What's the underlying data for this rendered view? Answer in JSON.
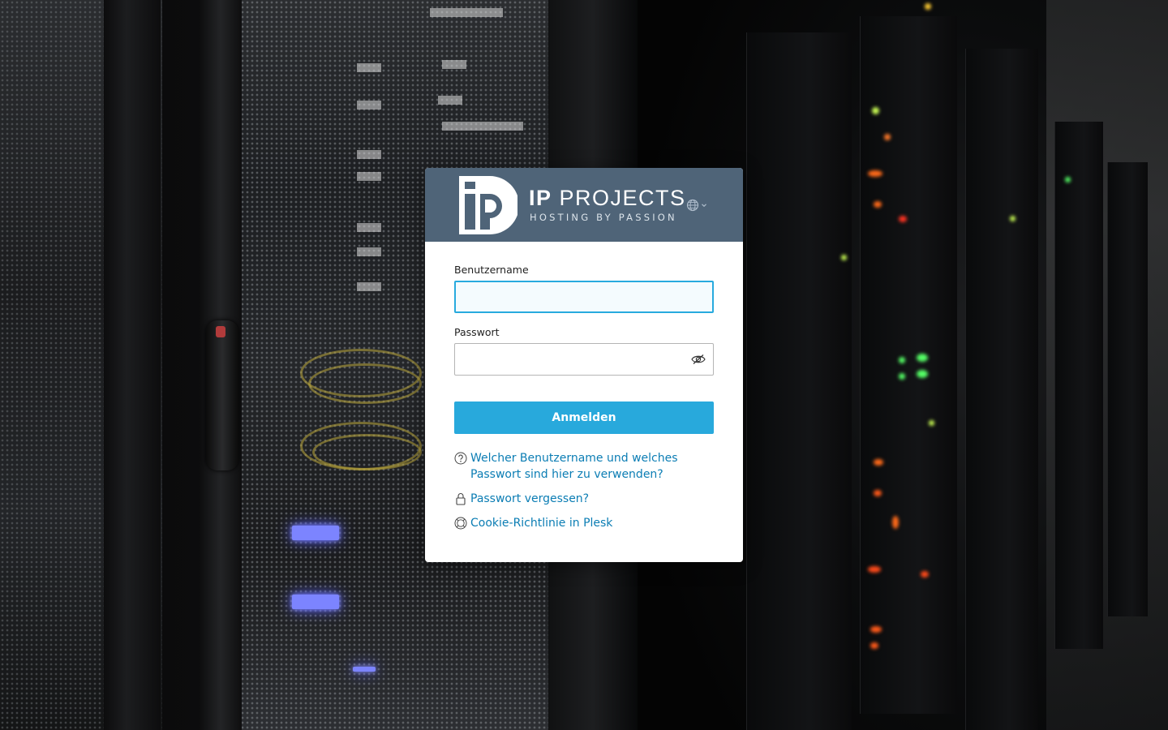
{
  "brand": {
    "name_bold": "IP",
    "name_rest": "PROJECTS",
    "tagline": "HOSTING BY PASSION"
  },
  "language_selector": {
    "icon": "globe-icon"
  },
  "login": {
    "username_label": "Benutzername",
    "username_value": "",
    "password_label": "Passwort",
    "password_value": "",
    "submit_label": "Anmelden"
  },
  "links": {
    "credentials_help": "Welcher Benutzername und welches Passwort sind hier zu verwenden?",
    "forgot_password": "Passwort vergessen?",
    "cookie_policy": "Cookie-Richtlinie in Plesk"
  },
  "colors": {
    "header_bg": "#4f6478",
    "accent": "#28a9dc",
    "link": "#0b7db4"
  }
}
